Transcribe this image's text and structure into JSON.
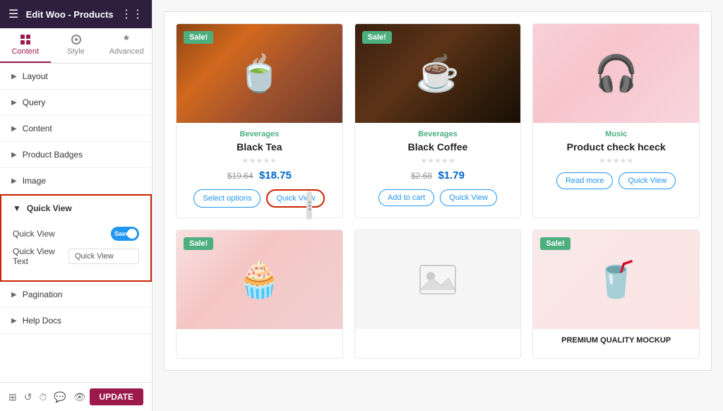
{
  "header": {
    "title": "Edit Woo - Products",
    "menu_icon": "grid-icon"
  },
  "tabs": [
    {
      "id": "content",
      "label": "Content",
      "active": true
    },
    {
      "id": "style",
      "label": "Style",
      "active": false
    },
    {
      "id": "advanced",
      "label": "Advanced",
      "active": false
    }
  ],
  "sidebar_items": [
    {
      "id": "layout",
      "label": "Layout"
    },
    {
      "id": "query",
      "label": "Query"
    },
    {
      "id": "content",
      "label": "Content"
    },
    {
      "id": "product-badges",
      "label": "Product Badges"
    },
    {
      "id": "image",
      "label": "Image"
    }
  ],
  "quick_view": {
    "section_label": "Quick View",
    "quick_view_label": "Quick View",
    "toggle_state": "on",
    "toggle_text": "Save",
    "text_label": "Quick View Text",
    "text_value": "Quick View"
  },
  "more_items": [
    {
      "id": "pagination",
      "label": "Pagination"
    },
    {
      "id": "help-docs",
      "label": "Help Docs"
    }
  ],
  "bottom_bar": {
    "update_label": "UPDATE"
  },
  "products": [
    {
      "id": "black-tea",
      "category": "Beverages",
      "name": "Black Tea",
      "stars": 0,
      "price_old": "$19.64",
      "price_new": "$18.75",
      "sale": true,
      "img_type": "black-tea",
      "img_emoji": "🍵",
      "buttons": [
        {
          "label": "Select options",
          "type": "outline"
        },
        {
          "label": "Quick View",
          "type": "outline highlighted"
        }
      ]
    },
    {
      "id": "black-coffee",
      "category": "Beverages",
      "name": "Black Coffee",
      "stars": 0,
      "price_old": "$2.68",
      "price_new": "$1.79",
      "sale": true,
      "img_type": "black-coffee",
      "img_emoji": "☕",
      "buttons": [
        {
          "label": "Add to cart",
          "type": "outline"
        },
        {
          "label": "Quick View",
          "type": "outline"
        }
      ]
    },
    {
      "id": "product-check",
      "category": "Music",
      "name": "Product check hceck",
      "stars": 0,
      "price_old": null,
      "price_new": null,
      "sale": false,
      "img_type": "headphones",
      "img_emoji": "🎧",
      "buttons": [
        {
          "label": "Read more",
          "type": "outline"
        },
        {
          "label": "Quick View",
          "type": "outline"
        }
      ]
    },
    {
      "id": "cupcake",
      "category": "",
      "name": "",
      "stars": 0,
      "price_old": null,
      "price_new": null,
      "sale": true,
      "img_type": "cupcake",
      "img_emoji": "🧁",
      "buttons": []
    },
    {
      "id": "placeholder",
      "category": "",
      "name": "",
      "stars": 0,
      "price_old": null,
      "price_new": null,
      "sale": false,
      "img_type": "placeholder",
      "img_emoji": "🖼",
      "buttons": []
    },
    {
      "id": "premium-cup",
      "category": "",
      "name": "PREMIUM QUALITY MOCKUP",
      "stars": 0,
      "price_old": null,
      "price_new": null,
      "sale": true,
      "img_type": "cup",
      "img_emoji": "🥤",
      "buttons": []
    }
  ]
}
